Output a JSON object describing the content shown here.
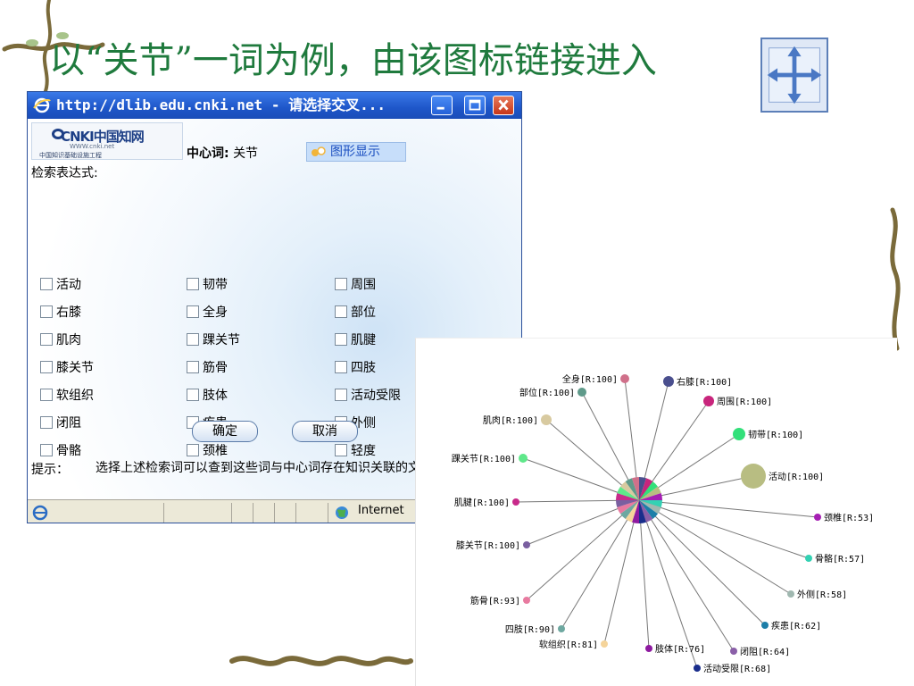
{
  "slide": {
    "title": "以“关节”一词为例，由该图标链接进入"
  },
  "window": {
    "title": "http://dlib.edu.cnki.net - 请选择交叉...",
    "logo": {
      "brand": "CNKI中国知网",
      "url": "WWW.cnki.net",
      "tagline": "中国知识基础设施工程"
    },
    "center_word_label": "中心词:",
    "center_word": "关节",
    "graph_button": "图形显示",
    "expression_label": "检索表达式:",
    "terms": [
      [
        "活动",
        "韧带",
        "周围"
      ],
      [
        "右膝",
        "全身",
        "部位"
      ],
      [
        "肌肉",
        "踝关节",
        "肌腱"
      ],
      [
        "膝关节",
        "筋骨",
        "四肢"
      ],
      [
        "软组织",
        "肢体",
        "活动受限"
      ],
      [
        "闭阻",
        "疾患",
        "外侧"
      ],
      [
        "骨骼",
        "颈椎",
        "轻度"
      ]
    ],
    "ok_button": "确定",
    "cancel_button": "取消",
    "tip_label": "提示：",
    "tip_text": "选择上述检索词可以查到这些词与中心词存在知识关联的文章。",
    "status_zone": "Internet"
  },
  "graph": {
    "nodes": [
      {
        "label": "右膝[R:100]",
        "color": "#4a4f8e"
      },
      {
        "label": "周围[R:100]",
        "color": "#c8257c"
      },
      {
        "label": "韧带[R:100]",
        "color": "#33e07a"
      },
      {
        "label": "活动[R:100]",
        "color": "#b8bd82"
      },
      {
        "label": "颈椎[R:53]",
        "color": "#a51fb3"
      },
      {
        "label": "骨骼[R:57]",
        "color": "#33d1b3"
      },
      {
        "label": "外侧[R:58]",
        "color": "#a0b8b0"
      },
      {
        "label": "疾患[R:62]",
        "color": "#1c7ea8"
      },
      {
        "label": "闭阻[R:64]",
        "color": "#8a5fa8"
      },
      {
        "label": "活动受限[R:68]",
        "color": "#1a2e8c"
      },
      {
        "label": "肢体[R:76]",
        "color": "#8e1aa0"
      },
      {
        "label": "软组织[R:81]",
        "color": "#f5d49a"
      },
      {
        "label": "四肢[R:90]",
        "color": "#6ea8a0"
      },
      {
        "label": "筋骨[R:93]",
        "color": "#e87aa0"
      },
      {
        "label": "膝关节[R:100]",
        "color": "#7a5fa0"
      },
      {
        "label": "肌腱[R:100]",
        "color": "#c82a8a"
      },
      {
        "label": "踝关节[R:100]",
        "color": "#5fe88a"
      },
      {
        "label": "肌肉[R:100]",
        "color": "#d8caa0"
      },
      {
        "label": "部位[R:100]",
        "color": "#5f9a8a"
      },
      {
        "label": "全身[R:100]",
        "color": "#d0708a"
      }
    ]
  }
}
